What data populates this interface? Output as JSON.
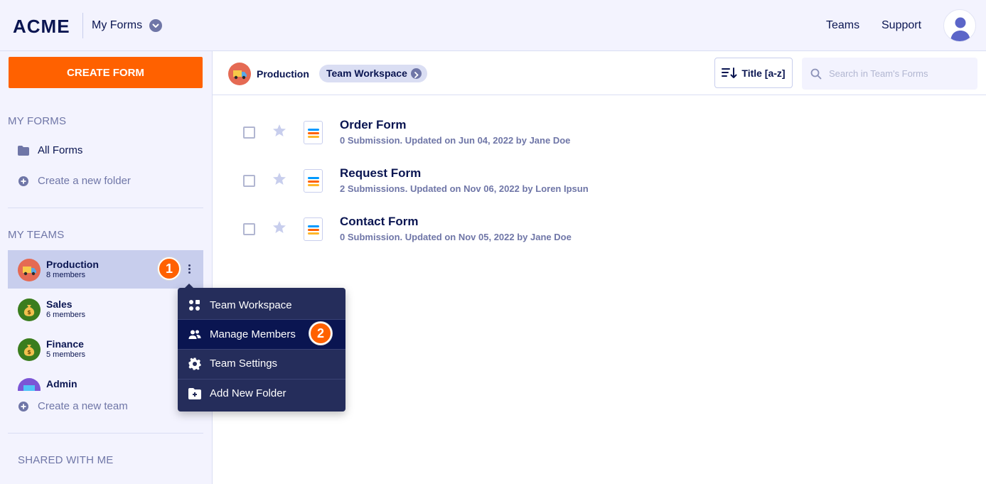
{
  "header": {
    "logo": "ACME",
    "workspace_selector": "My Forms",
    "nav": {
      "teams": "Teams",
      "support": "Support"
    }
  },
  "sidebar": {
    "create_button": "CREATE FORM",
    "my_forms_title": "MY FORMS",
    "all_forms": "All Forms",
    "create_folder": "Create a new folder",
    "my_teams_title": "MY TEAMS",
    "teams": [
      {
        "name": "Production",
        "members": "8 members",
        "icon": "truck-icon",
        "color": "#e56a53"
      },
      {
        "name": "Sales",
        "members": "6 members",
        "icon": "money-bag-icon",
        "color": "#3a7d1e"
      },
      {
        "name": "Finance",
        "members": "5 members",
        "icon": "money-bag-icon",
        "color": "#3a7d1e"
      },
      {
        "name": "Admin",
        "members": "",
        "icon": "monitor-icon",
        "color": "#7b55d6"
      }
    ],
    "create_team": "Create a new team",
    "shared_title": "SHARED WITH ME"
  },
  "toolbar": {
    "team_label": "Production",
    "workspace_pill": "Team Workspace",
    "sort_label": "Title [a-z]",
    "search_placeholder": "Search in Team's Forms"
  },
  "forms": [
    {
      "title": "Order Form",
      "meta": "0 Submission. Updated on Jun 04, 2022 by Jane Doe"
    },
    {
      "title": "Request Form",
      "meta": "2 Submissions. Updated on Nov 06, 2022 by Loren Ipsun"
    },
    {
      "title": "Contact Form",
      "meta": "0 Submission. Updated on Nov 05, 2022 by Jane Doe"
    }
  ],
  "context_menu": {
    "items": [
      {
        "label": "Team Workspace",
        "icon": "grid-icon"
      },
      {
        "label": "Manage Members",
        "icon": "users-icon"
      },
      {
        "label": "Team Settings",
        "icon": "gear-icon"
      },
      {
        "label": "Add New Folder",
        "icon": "folder-plus-icon"
      }
    ]
  },
  "step_badges": [
    "1",
    "2"
  ],
  "colors": {
    "accent": "#ff6100",
    "navy": "#0a1551",
    "menu_bg": "#252d5b",
    "sidebar_bg": "#f3f3fe"
  }
}
